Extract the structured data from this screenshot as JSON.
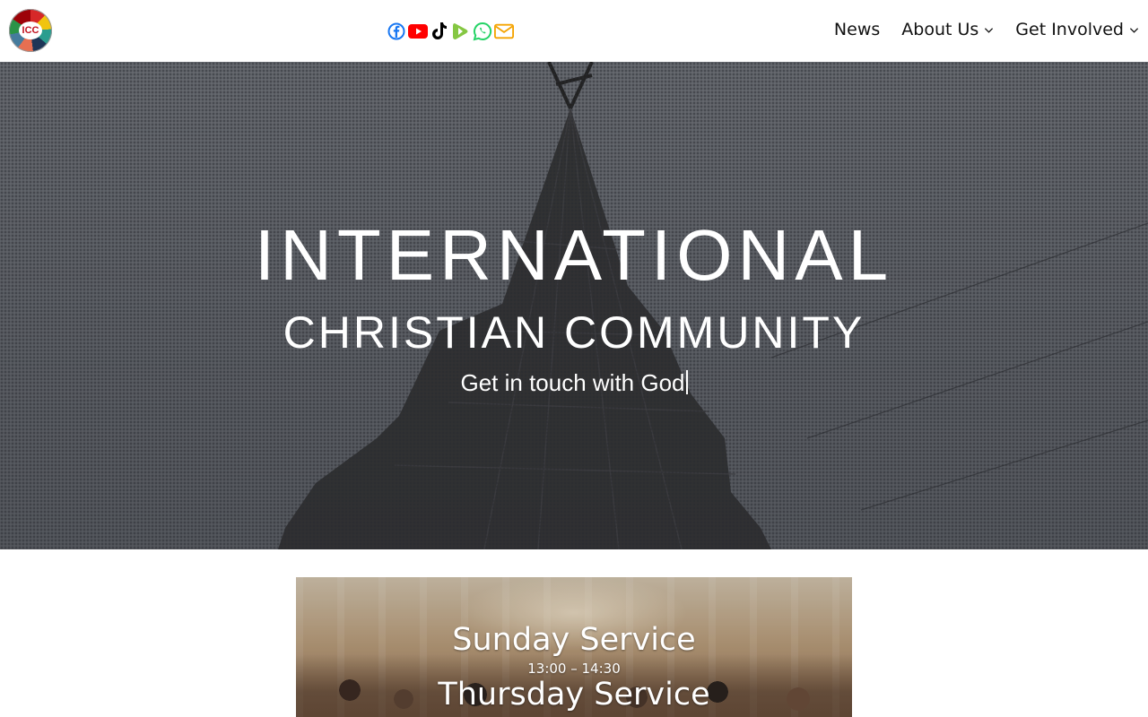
{
  "header": {
    "logo_text": "ICC",
    "social": [
      {
        "icon": "facebook-icon",
        "color": "#1877f2"
      },
      {
        "icon": "youtube-icon",
        "color": "#ff0000"
      },
      {
        "icon": "tiktok-icon",
        "color": "#000000"
      },
      {
        "icon": "rumble-icon",
        "color": "#85c742"
      },
      {
        "icon": "whatsapp-icon",
        "color": "#25d366"
      },
      {
        "icon": "email-icon",
        "color": "#f5a300"
      }
    ],
    "nav": {
      "news": "News",
      "about": "About Us",
      "involved": "Get Involved"
    }
  },
  "hero": {
    "title_line1": "INTERNATIONAL",
    "title_line2": "CHRISTIAN COMMUNITY",
    "tagline": "Get in touch with God"
  },
  "services": {
    "sunday_title": "Sunday Service",
    "sunday_time": "13:00 – 14:30",
    "thursday_title": "Thursday Service"
  }
}
